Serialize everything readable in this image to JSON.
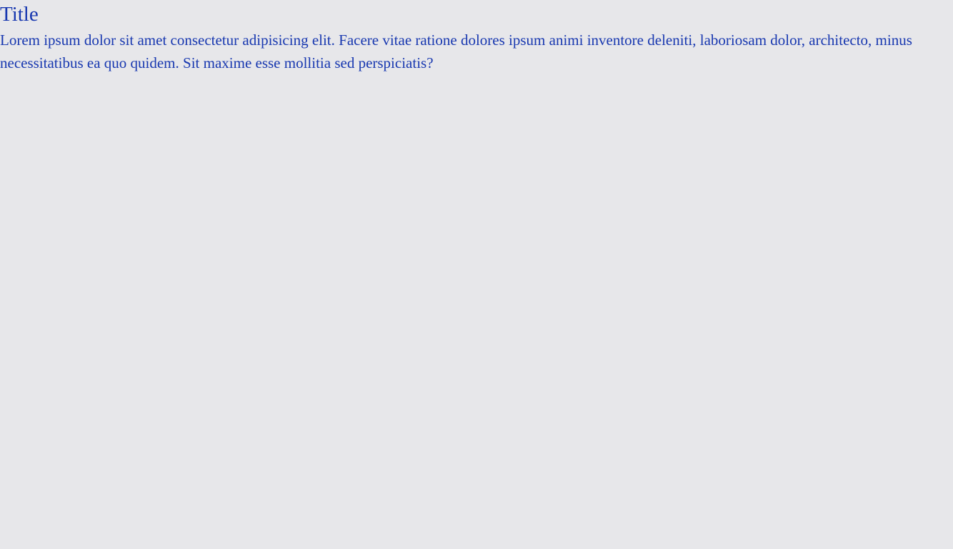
{
  "page": {
    "title": "Title",
    "body_text": "Lorem ipsum dolor sit amet consectetur adipisicing elit. Facere vitae ratione dolores ipsum animi inventore deleniti, laboriosam dolor, architecto, minus necessitatibus ea quo quidem. Sit maxime esse mollitia sed perspiciatis?"
  },
  "colors": {
    "background": "#e7e7ea",
    "text": "#1838b0"
  }
}
